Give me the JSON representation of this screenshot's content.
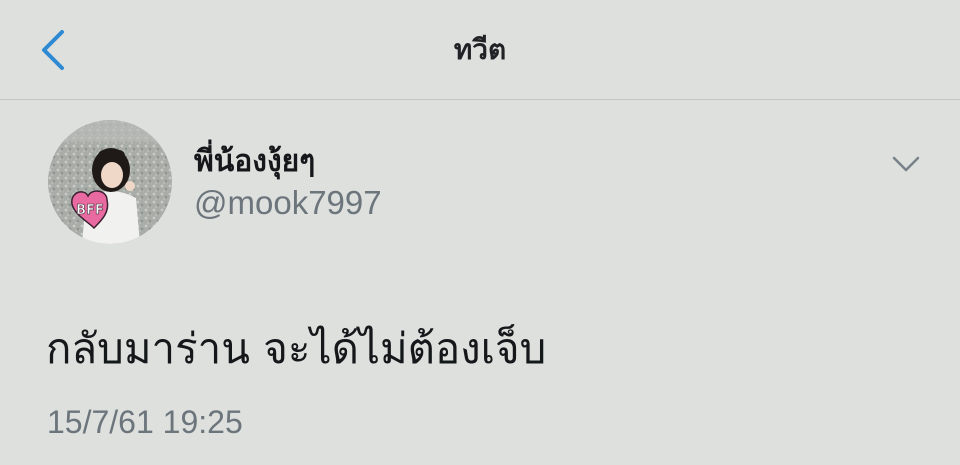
{
  "header": {
    "title": "ทวีต",
    "back_icon": "chevron-left-icon",
    "accent_color": "#2f8ad3"
  },
  "tweet": {
    "author": {
      "display_name": "พี่น้องงุ้ยๆ",
      "handle": "@mook7997",
      "avatar_badge_text": "BFF"
    },
    "more_icon": "chevron-down-icon",
    "text": "กลับมาร่าน จะได้ไม่ต้องเจ็บ",
    "timestamp": "15/7/61 19:25"
  },
  "colors": {
    "background": "#dde0dd",
    "primary_text": "#15181a",
    "secondary_text": "#6c757c",
    "badge_pink": "#e96aa0"
  }
}
